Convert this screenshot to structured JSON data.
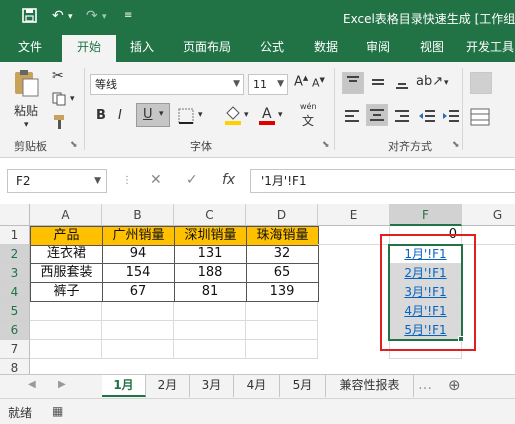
{
  "title_bar": {
    "title": "Excel表格目录快速生成  [工作组",
    "icons": [
      "save-icon",
      "undo-icon",
      "redo-icon",
      "customize-icon"
    ]
  },
  "ribbon_tabs": [
    "文件",
    "开始",
    "插入",
    "页面布局",
    "公式",
    "数据",
    "审阅",
    "视图",
    "开发工具"
  ],
  "ribbon": {
    "paste_label": "粘贴",
    "clipboard_label": "剪贴板",
    "font_name": "等线",
    "font_size": "11",
    "bold": "B",
    "italic": "I",
    "underline": "U",
    "font_group_label": "字体",
    "align_group_label": "对齐方式",
    "wen": "wén"
  },
  "formula_bar": {
    "name_box": "F2",
    "cancel": "✕",
    "confirm": "✓",
    "fx": "fx",
    "formula": "'1月'!F1"
  },
  "columns": [
    "A",
    "B",
    "C",
    "D",
    "E",
    "F",
    "G"
  ],
  "rows": [
    "1",
    "2",
    "3",
    "4",
    "5",
    "6",
    "7",
    "8"
  ],
  "table": {
    "headers": [
      "产品",
      "广州销量",
      "深圳销量",
      "珠海销量"
    ],
    "rows": [
      [
        "连衣裙",
        "94",
        "131",
        "32"
      ],
      [
        "西服套装",
        "154",
        "188",
        "65"
      ],
      [
        "裤子",
        "67",
        "81",
        "139"
      ]
    ]
  },
  "f1_value": "0",
  "f_links": [
    "1月'!F1",
    "2月'!F1",
    "3月'!F1",
    "4月'!F1",
    "5月'!F1"
  ],
  "sheet_tabs": [
    "1月",
    "2月",
    "3月",
    "4月",
    "5月",
    "兼容性报表"
  ],
  "active_sheet": "1月",
  "status": {
    "ready": "就绪"
  },
  "colors": {
    "brand": "#217346",
    "header_fill": "#ffc000",
    "link": "#0563c1",
    "highlight": "#e02020"
  }
}
